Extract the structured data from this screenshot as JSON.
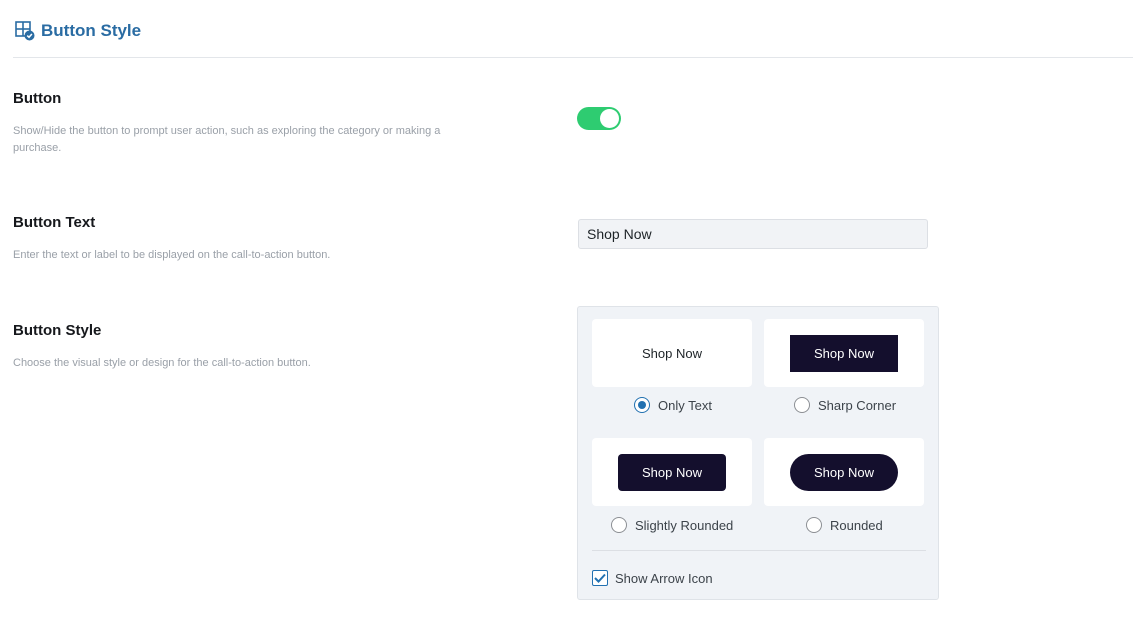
{
  "header": {
    "title": "Button Style",
    "icon": "grid-check-icon",
    "accent": "#2a6ca3"
  },
  "settings": [
    {
      "title": "Button",
      "description": "Show/Hide the button to prompt user action, such as exploring the category or making a purchase."
    },
    {
      "title": "Button Text",
      "description": "Enter the text or label to be displayed on the call-to-action button."
    },
    {
      "title": "Button Style",
      "description": "Choose the visual style or design for the call-to-action button."
    }
  ],
  "toggle": {
    "on": true,
    "color": "#2ecc71"
  },
  "button_text_input": {
    "value": "Shop Now"
  },
  "style_options": [
    {
      "preview": "Shop Now",
      "label": "Only Text",
      "selected": true
    },
    {
      "preview": "Shop Now",
      "label": "Sharp Corner",
      "selected": false
    },
    {
      "preview": "Shop Now",
      "label": "Slightly Rounded",
      "selected": false
    },
    {
      "preview": "Shop Now",
      "label": "Rounded",
      "selected": false
    }
  ],
  "preview_button_color": "#140f2d",
  "arrow_icon_option": {
    "label": "Show Arrow Icon",
    "checked": true
  }
}
